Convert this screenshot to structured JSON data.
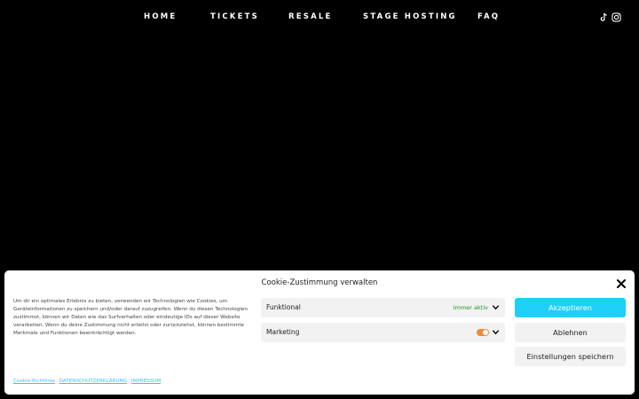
{
  "nav": {
    "items": [
      "HOME",
      "TICKETS",
      "RESALE",
      "STAGE HOSTING",
      "FAQ"
    ],
    "social": [
      "tiktok-icon",
      "instagram-icon"
    ]
  },
  "cookie_banner": {
    "title": "Cookie-Zustimmung verwalten",
    "description": "Um dir ein optimales Erlebnis zu bieten, verwenden wir Technologien wie Cookies, um Geräteinformationen zu speichern und/oder darauf zuzugreifen. Wenn du diesen Technologien zustimmst, können wir Daten wie das Surfverhalten oder eindeutige IDs auf dieser Website verarbeiten. Wenn du deine Zustimmung nicht erteilst oder zurückziehst, können bestimmte Merkmale und Funktionen beeinträchtigt werden.",
    "categories": [
      {
        "label": "Funktional",
        "status": "Immer aktiv"
      },
      {
        "label": "Marketing",
        "toggle": "on"
      }
    ],
    "buttons": {
      "accept": "Akzeptieren",
      "deny": "Ablehnen",
      "save": "Einstellungen speichern"
    },
    "links": [
      "Cookie-Richtlinie",
      "DATENSCHUTZERKLÄRUNG",
      "IMPRESSUM"
    ],
    "colors": {
      "accent": "#1ed0f7",
      "toggle_on": "#f28a3b",
      "status_active": "#1a9b1a"
    }
  }
}
